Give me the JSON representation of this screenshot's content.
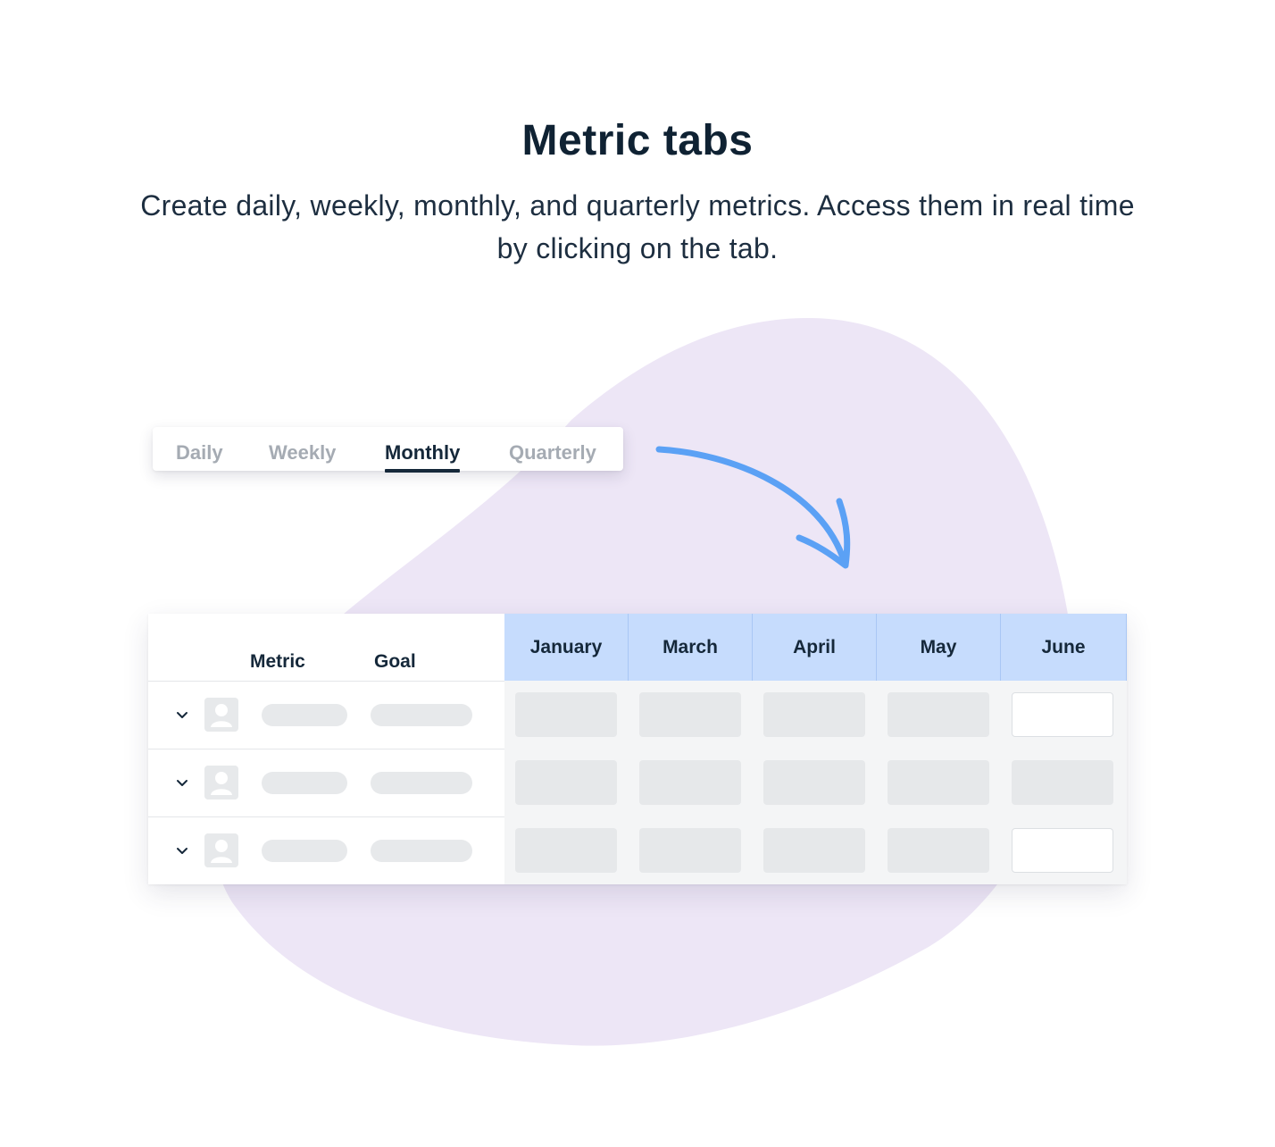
{
  "header": {
    "title": "Metric tabs",
    "subtitle": "Create daily, weekly, monthly, and quarterly metrics. Access them in real time by clicking on the tab."
  },
  "tabs": {
    "items": [
      {
        "label": "Daily",
        "active": false
      },
      {
        "label": "Weekly",
        "active": false
      },
      {
        "label": "Monthly",
        "active": true
      },
      {
        "label": "Quarterly",
        "active": false
      }
    ]
  },
  "table": {
    "columns": {
      "metric": "Metric",
      "goal": "Goal"
    },
    "months": [
      "January",
      "March",
      "April",
      "May",
      "June"
    ],
    "rows": 3,
    "editable_cells": [
      [
        0,
        4
      ],
      [
        2,
        4
      ]
    ]
  },
  "colors": {
    "accent": "#5ba1f5",
    "month_header_bg": "#c6dcfd",
    "blob": "#ede6f6",
    "text_dark": "#15283a",
    "tab_inactive": "#a5abb3"
  },
  "icons": {
    "row_toggle": "chevron-down-icon",
    "row_avatar": "user-icon",
    "callout": "curved-arrow-icon"
  }
}
